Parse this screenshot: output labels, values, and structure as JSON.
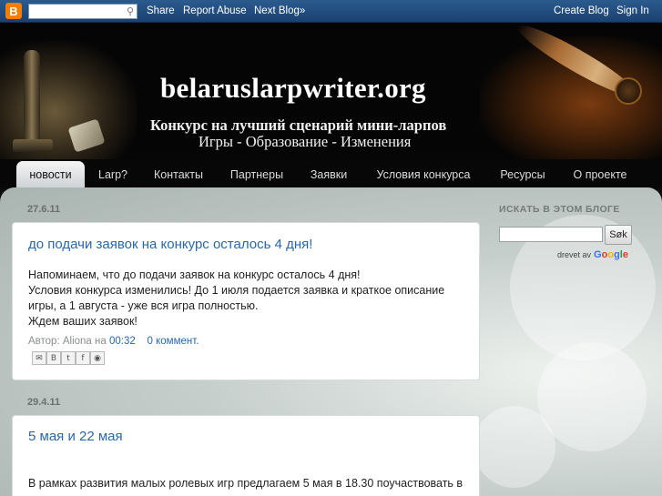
{
  "navbar": {
    "logo": "B",
    "search_placeholder": "",
    "share": "Share",
    "report_abuse": "Report Abuse",
    "next_blog": "Next Blog»",
    "create_blog": "Create Blog",
    "sign_in": "Sign In"
  },
  "header": {
    "title": "belaruslarpwriter.org",
    "desc_line1": "Конкурс на лучший сценарий мини-ларпов",
    "desc_line2": "Игры - Образование - Изменения"
  },
  "tabs": [
    "новости",
    "Larp?",
    "Контакты",
    "Партнеры",
    "Заявки",
    "Условия конкурса",
    "Ресурсы",
    "О проекте"
  ],
  "active_tab": "новости",
  "posts": [
    {
      "date": "27.6.11",
      "title": "до подачи заявок на конкурс осталось 4 дня!",
      "body_lines": [
        "Напоминаем, что до подачи заявок на конкурс осталось 4 дня!",
        "Условия конкурса изменились! До 1 июля подается заявка и краткое описание",
        "игры, а 1 августа - уже вся игра полностью.",
        "Ждем ваших заявок!"
      ],
      "author_label": "Автор: Aliona на",
      "time": "00:32",
      "comments": "0 коммент."
    },
    {
      "date": "29.4.11",
      "title": "5 мая и 22 мая",
      "body_lines": [
        "В рамках развития малых ролевых игр предлагаем 5 мая в 18.30 поучаствовать в"
      ]
    }
  ],
  "sidebar": {
    "search_title": "ИСКАТЬ В ЭТОМ БЛОГЕ",
    "search_button": "Søk",
    "powered_by": "drevet av",
    "google": "Google"
  },
  "colors": {
    "navbar": "#1b4170",
    "link": "#2a67a8",
    "blogger_orange": "#f57d00"
  }
}
